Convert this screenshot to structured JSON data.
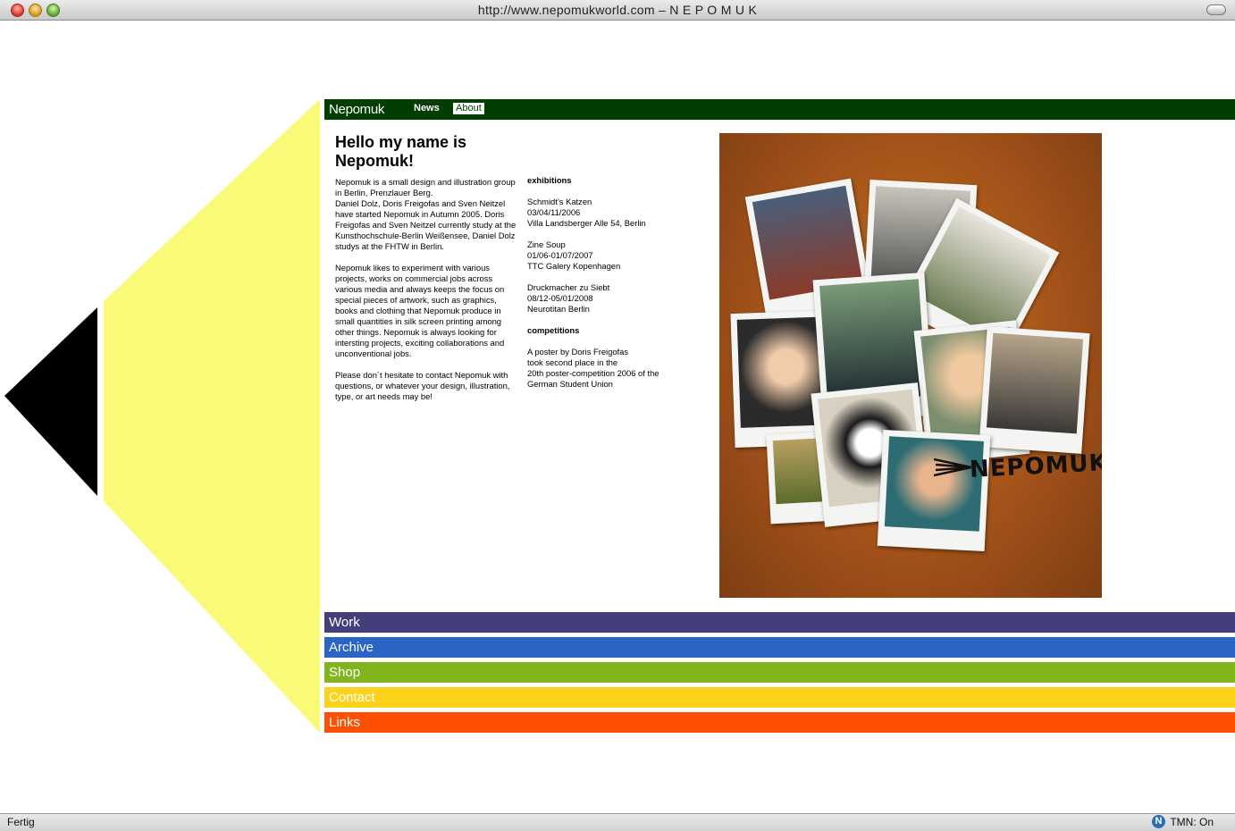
{
  "window": {
    "title": "http://www.nepomukworld.com – N E P O M U K"
  },
  "status": {
    "left": "Fertig",
    "right": "TMN: On"
  },
  "nav": {
    "brand": "Nepomuk",
    "items": [
      {
        "label": "News"
      },
      {
        "label": "About"
      }
    ]
  },
  "about": {
    "heading": "Hello my name is Nepomuk!",
    "paragraphs": [
      "Nepomuk is a small design and illustration group in Berlin, Prenzlauer Berg.\nDaniel Dolz, Doris Freigofas and Sven Neitzel have started Nepomuk in Autumn 2005. Doris Freigofas and Sven Neitzel currently study at the Kunsthochschule-Berlin Weißensee, Daniel Dolz studys at the FHTW in Berlin.",
      "Nepomuk likes to experiment with various projects, works on commercial jobs across various media and always keeps the focus on special pieces of artwork, such as graphics, books and clothing that Nepomuk produce in small quantities in silk screen printing among other things. Nepomuk is always looking for intersting projects, exciting collaborations and unconventional jobs.",
      "Please don´t hesitate to contact Nepomuk with questions, or whatever your design, illustration, type, or art needs may be!"
    ],
    "exhibitions_title": "exhibitions",
    "exhibitions": [
      "Schmidt’s Katzen\n03/04/11/2006\nVilla Landsberger Alle 54, Berlin",
      "Zine Soup\n01/06-01/07/2007\nTTC Galery Kopenhagen",
      "Druckmacher zu Siebt\n08/12-05/01/2008\nNeurotitan Berlin"
    ],
    "competitions_title": "competitions",
    "competitions": [
      "A poster by Doris Freigofas\ntook second place in the\n20th poster-competition 2006 of the\nGerman Student Union"
    ],
    "photo_logo": "NEPOMUK"
  },
  "menu": [
    {
      "label": "Work",
      "color": "#443f7a"
    },
    {
      "label": "Archive",
      "color": "#2a64c4"
    },
    {
      "label": "Shop",
      "color": "#82b41e"
    },
    {
      "label": "Contact",
      "color": "#fdd21a"
    },
    {
      "label": "Links",
      "color": "#fd5005"
    }
  ],
  "colors": {
    "nav_bg": "#003d00",
    "yellow_shape": "#f9fb78",
    "black_shape": "#000000"
  }
}
